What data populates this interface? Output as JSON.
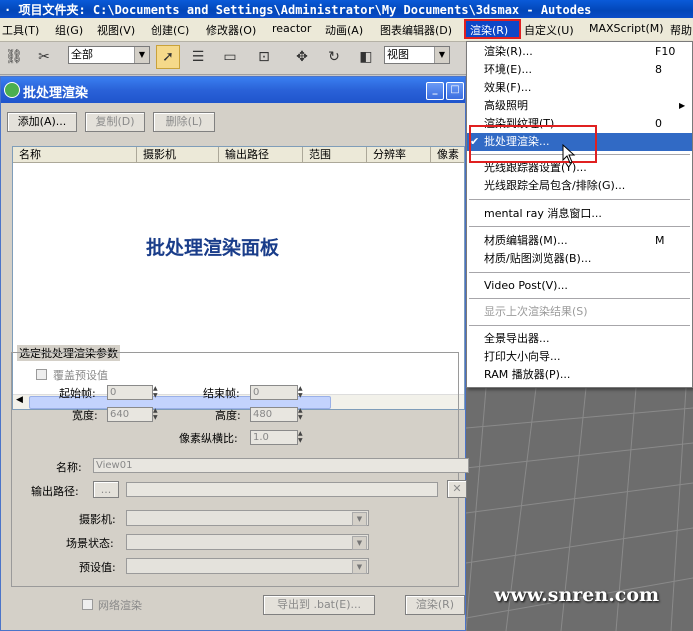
{
  "title_bar": {
    "text": "· 项目文件夹: C:\\Documents and Settings\\Administrator\\My Documents\\3dsmax  - Autodes"
  },
  "menubar": {
    "items": [
      "工具(T)",
      "组(G)",
      "视图(V)",
      "创建(C)",
      "修改器(O)",
      "reactor",
      "动画(A)",
      "图表编辑器(D)",
      "渲染(R)",
      "自定义(U)",
      "MAXScript(M)",
      "帮助"
    ]
  },
  "toolbar": {
    "selection_filter": "全部",
    "reference_coord": "视图"
  },
  "batch_window": {
    "title": "批处理渲染",
    "buttons": {
      "add": "添加(A)...",
      "copy": "复制(D)",
      "delete": "删除(L)"
    },
    "columns": [
      "名称",
      "摄影机",
      "输出路径",
      "范围",
      "分辨率",
      "像素"
    ],
    "panel_label": "批处理渲染面板",
    "params_group": "选定批处理渲染参数",
    "override_preset": "覆盖预设值",
    "start_frame": {
      "label": "起始帧:",
      "value": "0"
    },
    "end_frame": {
      "label": "结束帧:",
      "value": "0"
    },
    "width": {
      "label": "宽度:",
      "value": "640"
    },
    "height": {
      "label": "高度:",
      "value": "480"
    },
    "pixel_aspect": {
      "label": "像素纵横比:",
      "value": "1.0"
    },
    "name": {
      "label": "名称:",
      "value": "View01"
    },
    "output_path": {
      "label": "输出路径:",
      "browse": "...",
      "clear": "✕"
    },
    "camera": {
      "label": "摄影机:"
    },
    "scene_state": {
      "label": "场景状态:"
    },
    "preset": {
      "label": "预设值:"
    },
    "net_render": "网络渲染",
    "export_bat": "导出到 .bat(E)...",
    "render": "渲染(R)"
  },
  "render_menu": {
    "items": [
      {
        "label": "渲染(R)...",
        "shortcut": "F10"
      },
      {
        "label": "环境(E)...",
        "shortcut": "8"
      },
      {
        "label": "效果(F)...",
        "shortcut": ""
      },
      {
        "label": "高级照明",
        "shortcut": "▶"
      },
      {
        "label": "渲染到纹理(T)...",
        "shortcut": "0"
      },
      {
        "label": "批处理渲染...",
        "shortcut": "",
        "checked": "✔"
      },
      {
        "label": "光线跟踪器设置(Y)...",
        "shortcut": ""
      },
      {
        "label": "光线跟踪全局包含/排除(G)...",
        "shortcut": ""
      },
      {
        "label": "mental ray 消息窗口...",
        "shortcut": ""
      },
      {
        "label": "材质编辑器(M)...",
        "shortcut": "M"
      },
      {
        "label": "材质/贴图浏览器(B)...",
        "shortcut": ""
      },
      {
        "label": "Video Post(V)...",
        "shortcut": ""
      },
      {
        "label": "显示上次渲染结果(S)",
        "shortcut": ""
      },
      {
        "label": "全景导出器...",
        "shortcut": ""
      },
      {
        "label": "打印大小向导...",
        "shortcut": ""
      },
      {
        "label": "RAM 播放器(P)...",
        "shortcut": ""
      }
    ]
  },
  "watermark": "www.snren.com",
  "colors": {
    "highlight": "#316ac5",
    "annotation": "#e02020"
  }
}
